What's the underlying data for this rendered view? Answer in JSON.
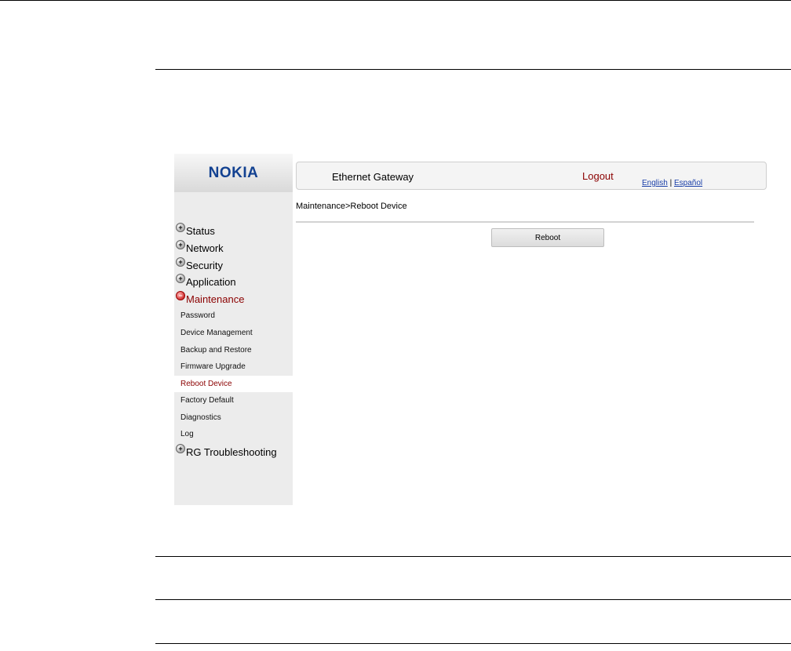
{
  "brand": {
    "logo_text": "NOKIA",
    "color": "#124191"
  },
  "header": {
    "app_title": "Ethernet Gateway",
    "logout_label": "Logout",
    "lang_english": "English",
    "lang_separator": "|",
    "lang_spanish": "Español"
  },
  "breadcrumb": "Maintenance>Reboot Device",
  "sidebar": {
    "menu": [
      {
        "label": "Status",
        "icon": "plus-icon"
      },
      {
        "label": "Network",
        "icon": "plus-icon"
      },
      {
        "label": "Security",
        "icon": "plus-icon"
      },
      {
        "label": "Application",
        "icon": "plus-icon"
      },
      {
        "label": "Maintenance",
        "icon": "minus-icon",
        "active": true
      }
    ],
    "maintenance_items": [
      "Password",
      "Device Management",
      "Backup and Restore",
      "Firmware Upgrade",
      "Reboot Device",
      "Factory Default",
      "Diagnostics",
      "Log"
    ],
    "selected_item": "Reboot Device",
    "troubleshooting": {
      "label": "RG Troubleshooting",
      "icon": "plus-icon"
    }
  },
  "main": {
    "reboot_button_label": "Reboot"
  },
  "colors": {
    "active": "#8b0000",
    "link": "#1a3fa8",
    "sidebar_bg": "#ececec"
  }
}
